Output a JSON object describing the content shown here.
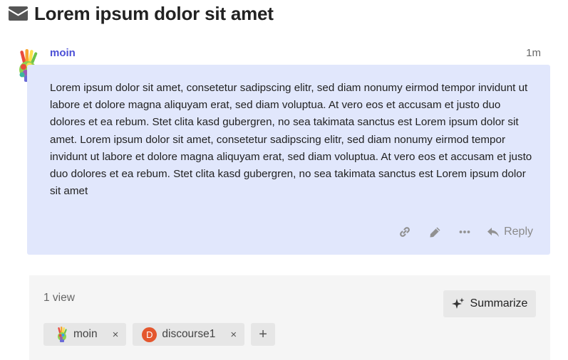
{
  "topic": {
    "title": "Lorem ipsum dolor sit amet",
    "title_icon": "envelope-icon"
  },
  "post": {
    "username": "moin",
    "time": "1m",
    "avatar_icon": "rainbow-hand-avatar",
    "body": "Lorem ipsum dolor sit amet, consetetur sadipscing elitr, sed diam nonumy eirmod tempor invidunt ut labore et dolore magna aliquyam erat, sed diam voluptua. At vero eos et accusam et justo duo dolores et ea rebum. Stet clita kasd gubergren, no sea takimata sanctus est Lorem ipsum dolor sit amet. Lorem ipsum dolor sit amet, consetetur sadipscing elitr, sed diam nonumy eirmod tempor invidunt ut labore et dolore magna aliquyam erat, sed diam voluptua. At vero eos et accusam et justo duo dolores et ea rebum. Stet clita kasd gubergren, no sea takimata sanctus est Lorem ipsum dolor sit amet",
    "actions": {
      "link_icon": "link-icon",
      "edit_icon": "pencil-icon",
      "more_icon": "ellipsis-icon",
      "reply_label": "Reply"
    }
  },
  "footer": {
    "views": "1 view",
    "summarize_label": "Summarize",
    "participants": [
      {
        "name": "moin",
        "avatar": "rainbow-hand-avatar"
      },
      {
        "name": "discourse1",
        "avatar_letter": "D",
        "avatar_color": "#e4572e"
      }
    ],
    "remove_symbol": "×",
    "add_symbol": "+"
  },
  "colors": {
    "post_background": "#e1e7fc",
    "username": "#4b4fd6",
    "footer_background": "#f5f5f5"
  }
}
